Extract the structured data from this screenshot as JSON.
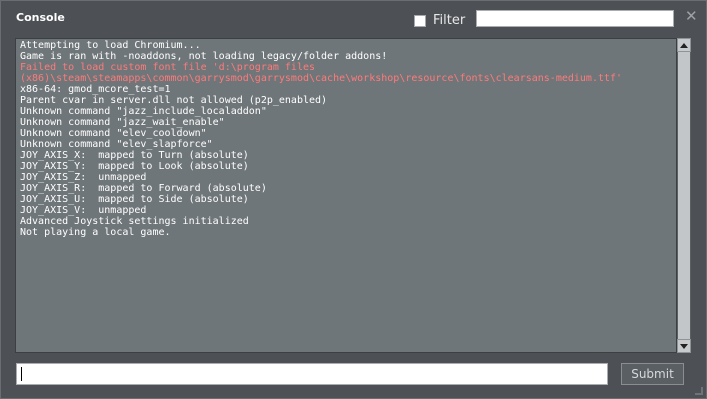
{
  "window": {
    "title": "Console"
  },
  "filter": {
    "label": "Filter",
    "checked": false,
    "value": ""
  },
  "close": {
    "icon": "close-icon",
    "glyph": "✕"
  },
  "log": {
    "lines": [
      {
        "text": "Attempting to load Chromium...",
        "type": "normal"
      },
      {
        "text": "Game is ran with -noaddons, not loading legacy/folder addons!",
        "type": "normal"
      },
      {
        "text": "Failed to load custom font file 'd:\\program files",
        "type": "error"
      },
      {
        "text": "(x86)\\steam\\steamapps\\common\\garrysmod\\garrysmod\\cache\\workshop\\resource\\fonts\\clearsans-medium.ttf'",
        "type": "error"
      },
      {
        "text": "x86-64: gmod_mcore_test=1",
        "type": "normal"
      },
      {
        "text": "Parent cvar in server.dll not allowed (p2p_enabled)",
        "type": "normal"
      },
      {
        "text": "Unknown command \"jazz_include_localaddon\"",
        "type": "normal"
      },
      {
        "text": "Unknown command \"jazz_wait_enable\"",
        "type": "normal"
      },
      {
        "text": "Unknown command \"elev_cooldown\"",
        "type": "normal"
      },
      {
        "text": "Unknown command \"elev_slapforce\"",
        "type": "normal"
      },
      {
        "text": "JOY_AXIS_X:  mapped to Turn (absolute)",
        "type": "normal"
      },
      {
        "text": "JOY_AXIS_Y:  mapped to Look (absolute)",
        "type": "normal"
      },
      {
        "text": "JOY_AXIS_Z:  unmapped",
        "type": "normal"
      },
      {
        "text": "JOY_AXIS_R:  mapped to Forward (absolute)",
        "type": "normal"
      },
      {
        "text": "JOY_AXIS_U:  mapped to Side (absolute)",
        "type": "normal"
      },
      {
        "text": "JOY_AXIS_V:  unmapped",
        "type": "normal"
      },
      {
        "text": "Advanced Joystick settings initialized",
        "type": "normal"
      },
      {
        "text": "Not playing a local game.",
        "type": "normal"
      }
    ]
  },
  "command": {
    "value": ""
  },
  "submit": {
    "label": "Submit"
  },
  "colors": {
    "error": "#ff7a7a",
    "text": "#ffffff",
    "log_bg": "#6f7679",
    "window_bg": "#4d5155"
  }
}
